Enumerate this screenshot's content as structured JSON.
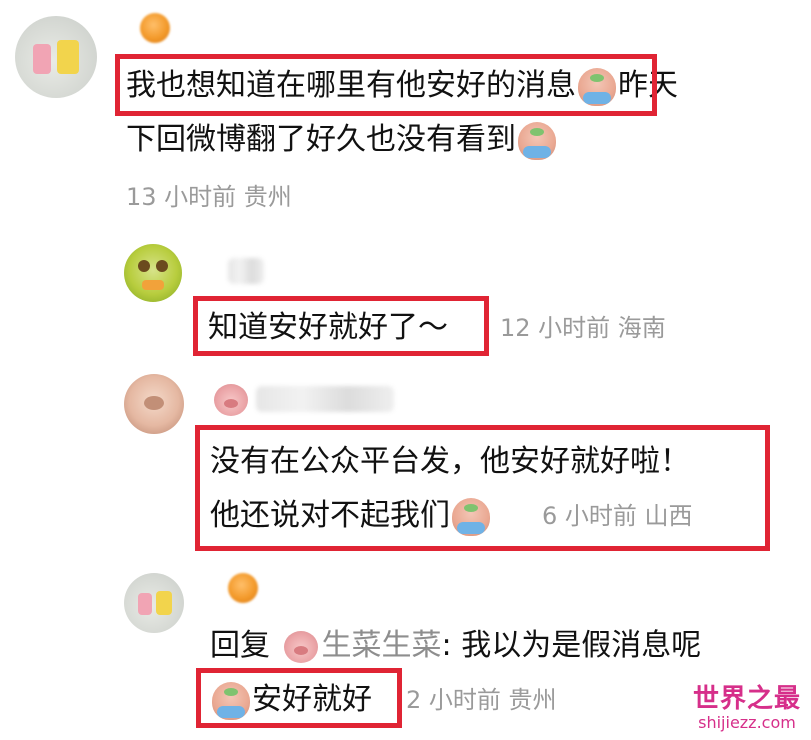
{
  "comments": [
    {
      "line1": "我也想知道在哪里有他安好的消息",
      "line1_tail": "昨天",
      "line2": "下回微博翻了好久也没有看到",
      "meta": "13 小时前  贵州"
    },
    {
      "text": "知道安好就好了～",
      "meta": "12 小时前  海南"
    },
    {
      "line1": "没有在公众平台发，他安好就好啦！",
      "line2": "他还说对不起我们",
      "meta": "6 小时前  山西"
    },
    {
      "reply_prefix": "回复",
      "reply_name": "生菜生菜",
      "reply_body": ": 我以为是假消息呢",
      "line2": "安好就好",
      "meta": "2 小时前  贵州"
    }
  ],
  "watermark": {
    "title": "世界之最",
    "url": "shijiezz.com"
  },
  "icons": [
    "crying-emoji-icon",
    "pig-emoji-icon",
    "orange-badge-icon"
  ],
  "colors": {
    "highlight_box": "#e02434",
    "meta_text": "#9a9a9a",
    "watermark": "#d62f8a"
  }
}
